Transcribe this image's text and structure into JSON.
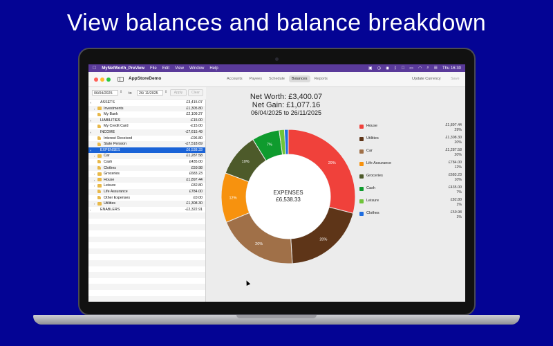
{
  "headline": "View balances and balance breakdown",
  "menubar": {
    "app_name": "MyNetWorth_PreView",
    "items": [
      "File",
      "Edit",
      "View",
      "Window",
      "Help"
    ],
    "clock": "Thu 16:30"
  },
  "toolbar": {
    "doc_title": "AppStoreDemo",
    "tabs": [
      "Accounts",
      "Payees",
      "Schedule",
      "Balances",
      "Reports"
    ],
    "active_tab": "Balances",
    "update_currency": "Update Currency",
    "save": "Save"
  },
  "datebar": {
    "from": "06/04/2025",
    "to_label": "to",
    "to": "26/ 11/2025",
    "apply": "Apply",
    "clear": "Clear"
  },
  "tree": [
    {
      "label": "ASSETS",
      "amount": "£3,415.07",
      "indent": 0,
      "disc": "˅",
      "icon": "none"
    },
    {
      "label": "Investments",
      "amount": "£1,305.80",
      "indent": 1,
      "disc": "›",
      "icon": "folder"
    },
    {
      "label": "My Bank",
      "amount": "£2,109.27",
      "indent": 1,
      "disc": "",
      "icon": "account"
    },
    {
      "label": "LIABILITIES",
      "amount": "-£15.00",
      "indent": 0,
      "disc": "˅",
      "icon": "none"
    },
    {
      "label": "My Credit Card",
      "amount": "-£15.00",
      "indent": 1,
      "disc": "",
      "icon": "account"
    },
    {
      "label": "INCOME",
      "amount": "-£7,615.49",
      "indent": 0,
      "disc": "˅",
      "icon": "none"
    },
    {
      "label": "Interest Received",
      "amount": "-£96.80",
      "indent": 1,
      "disc": "",
      "icon": "account"
    },
    {
      "label": "State Pension",
      "amount": "-£7,518.69",
      "indent": 1,
      "disc": "",
      "icon": "account"
    },
    {
      "label": "EXPENSES",
      "amount": "£6,538.33",
      "indent": 0,
      "disc": "˅",
      "icon": "none",
      "selected": true
    },
    {
      "label": "Car",
      "amount": "£1,287.58",
      "indent": 1,
      "disc": "›",
      "icon": "folder"
    },
    {
      "label": "Cash",
      "amount": "£435.00",
      "indent": 1,
      "disc": "",
      "icon": "account"
    },
    {
      "label": "Clothes",
      "amount": "£59.98",
      "indent": 1,
      "disc": "",
      "icon": "account"
    },
    {
      "label": "Groceries",
      "amount": "£683.23",
      "indent": 1,
      "disc": "›",
      "icon": "folder"
    },
    {
      "label": "House",
      "amount": "£1,897.44",
      "indent": 1,
      "disc": "›",
      "icon": "folder"
    },
    {
      "label": "Leisure",
      "amount": "£82.80",
      "indent": 1,
      "disc": "›",
      "icon": "folder"
    },
    {
      "label": "Life Assurance",
      "amount": "£784.00",
      "indent": 1,
      "disc": "",
      "icon": "account"
    },
    {
      "label": "Other Expenses",
      "amount": "£0.00",
      "indent": 1,
      "disc": "",
      "icon": "account"
    },
    {
      "label": "Utilities",
      "amount": "£1,308.30",
      "indent": 1,
      "disc": "›",
      "icon": "folder"
    },
    {
      "label": "ENABLERS",
      "amount": "-£2,322.91",
      "indent": 0,
      "disc": "›",
      "icon": "none"
    }
  ],
  "summary": {
    "net_worth": "Net Worth: £3,400.07",
    "net_gain": "Net Gain: £1,077.16",
    "period": "06/04/2025  to  26/11/2025"
  },
  "center": {
    "label": "EXPENSES",
    "amount": "£6,538.33"
  },
  "chart_data": {
    "type": "pie",
    "donut": true,
    "slices": [
      {
        "name": "House",
        "value": 1897.44,
        "value_label": "£1,897.44",
        "pct": "29%",
        "color": "#f0413b",
        "show_pct": true
      },
      {
        "name": "Utilities",
        "value": 1308.3,
        "value_label": "£1,308.30",
        "pct": "20%",
        "color": "#5e3518",
        "show_pct": true
      },
      {
        "name": "Car",
        "value": 1287.58,
        "value_label": "£1,287.58",
        "pct": "20%",
        "color": "#a07048",
        "show_pct": true
      },
      {
        "name": "Life Assurance",
        "value": 784.0,
        "value_label": "£784.00",
        "pct": "12%",
        "color": "#f7920e",
        "show_pct": true
      },
      {
        "name": "Groceries",
        "value": 683.23,
        "value_label": "£683.23",
        "pct": "10%",
        "color": "#4d5a2a",
        "show_pct": true
      },
      {
        "name": "Cash",
        "value": 435.0,
        "value_label": "£435.00",
        "pct": "7%",
        "color": "#0f9b2e",
        "show_pct": true
      },
      {
        "name": "Leisure",
        "value": 82.8,
        "value_label": "£82.80",
        "pct": "1%",
        "color": "#6fc43a",
        "show_pct": false
      },
      {
        "name": "Clothes",
        "value": 59.98,
        "value_label": "£59.98",
        "pct": "1%",
        "color": "#1e6de0",
        "show_pct": false
      }
    ]
  }
}
